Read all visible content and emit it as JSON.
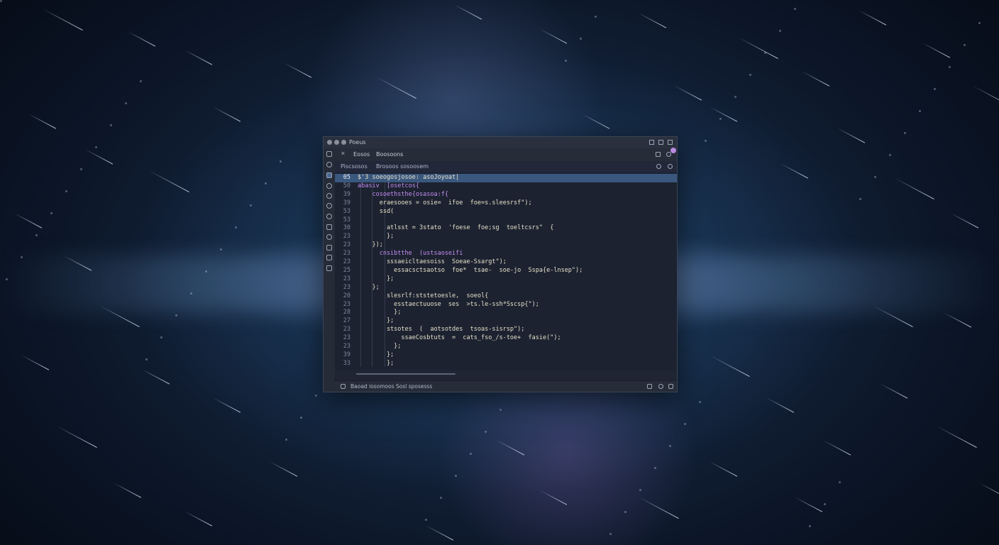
{
  "window": {
    "title": "Poeus"
  },
  "tabs": [
    {
      "label": "Eosos"
    },
    {
      "label": "Boosoons"
    }
  ],
  "breadcrumbs": [
    {
      "label": "Piscsosos"
    },
    {
      "label": "Brosoos sosoosem"
    }
  ],
  "editor": {
    "lines": [
      {
        "num": "05",
        "text": "$'3 soeogosjosoe: asoJoyoat|",
        "active": true
      },
      {
        "num": "50",
        "text": "abasiv  [osetcos{"
      },
      {
        "num": "39",
        "text": "    cosoethsthe{osasoa:f{"
      },
      {
        "num": "39",
        "text": "      eraesooes = osie=  ifoe  foe=s.sleesrsf\");"
      },
      {
        "num": "53",
        "text": "      ssd("
      },
      {
        "num": "53",
        "text": ""
      },
      {
        "num": "30",
        "text": "        atlsst = 3stato  'foese  foe;sg  toeltcsrs\"  {"
      },
      {
        "num": "23",
        "text": "        };"
      },
      {
        "num": "23",
        "text": "    });"
      },
      {
        "num": "23",
        "text": "      cnsibtthe  (ustsaoseifi"
      },
      {
        "num": "23",
        "text": "        sssaeicltaesoiss  Soeae-Ssargt\");"
      },
      {
        "num": "25",
        "text": "          essacsctsaotso  foe*  tsae-  soe-jo  Sspa{e-lnsep\");"
      },
      {
        "num": "23",
        "text": "        };"
      },
      {
        "num": "23",
        "text": "    };"
      },
      {
        "num": "20",
        "text": "        slesrlf:ststetoesle,  soeol{"
      },
      {
        "num": "23",
        "text": "          esstaectuuose  ses  >ts.le-ssh*Sscsp{\");"
      },
      {
        "num": "28",
        "text": "          };"
      },
      {
        "num": "27",
        "text": "        };"
      },
      {
        "num": "23",
        "text": "        stsotes  (  aotsotdes  tsoas-sisrsp\");"
      },
      {
        "num": "23",
        "text": "            ssaeCosbtuts  =  cats_fso_/s-toe+  fasie(\");"
      },
      {
        "num": "23",
        "text": "          };"
      },
      {
        "num": "39",
        "text": "        };"
      },
      {
        "num": "33",
        "text": "        };"
      }
    ]
  },
  "statusbar": {
    "text": "Baoad iosomoos Sosl sposesss"
  }
}
